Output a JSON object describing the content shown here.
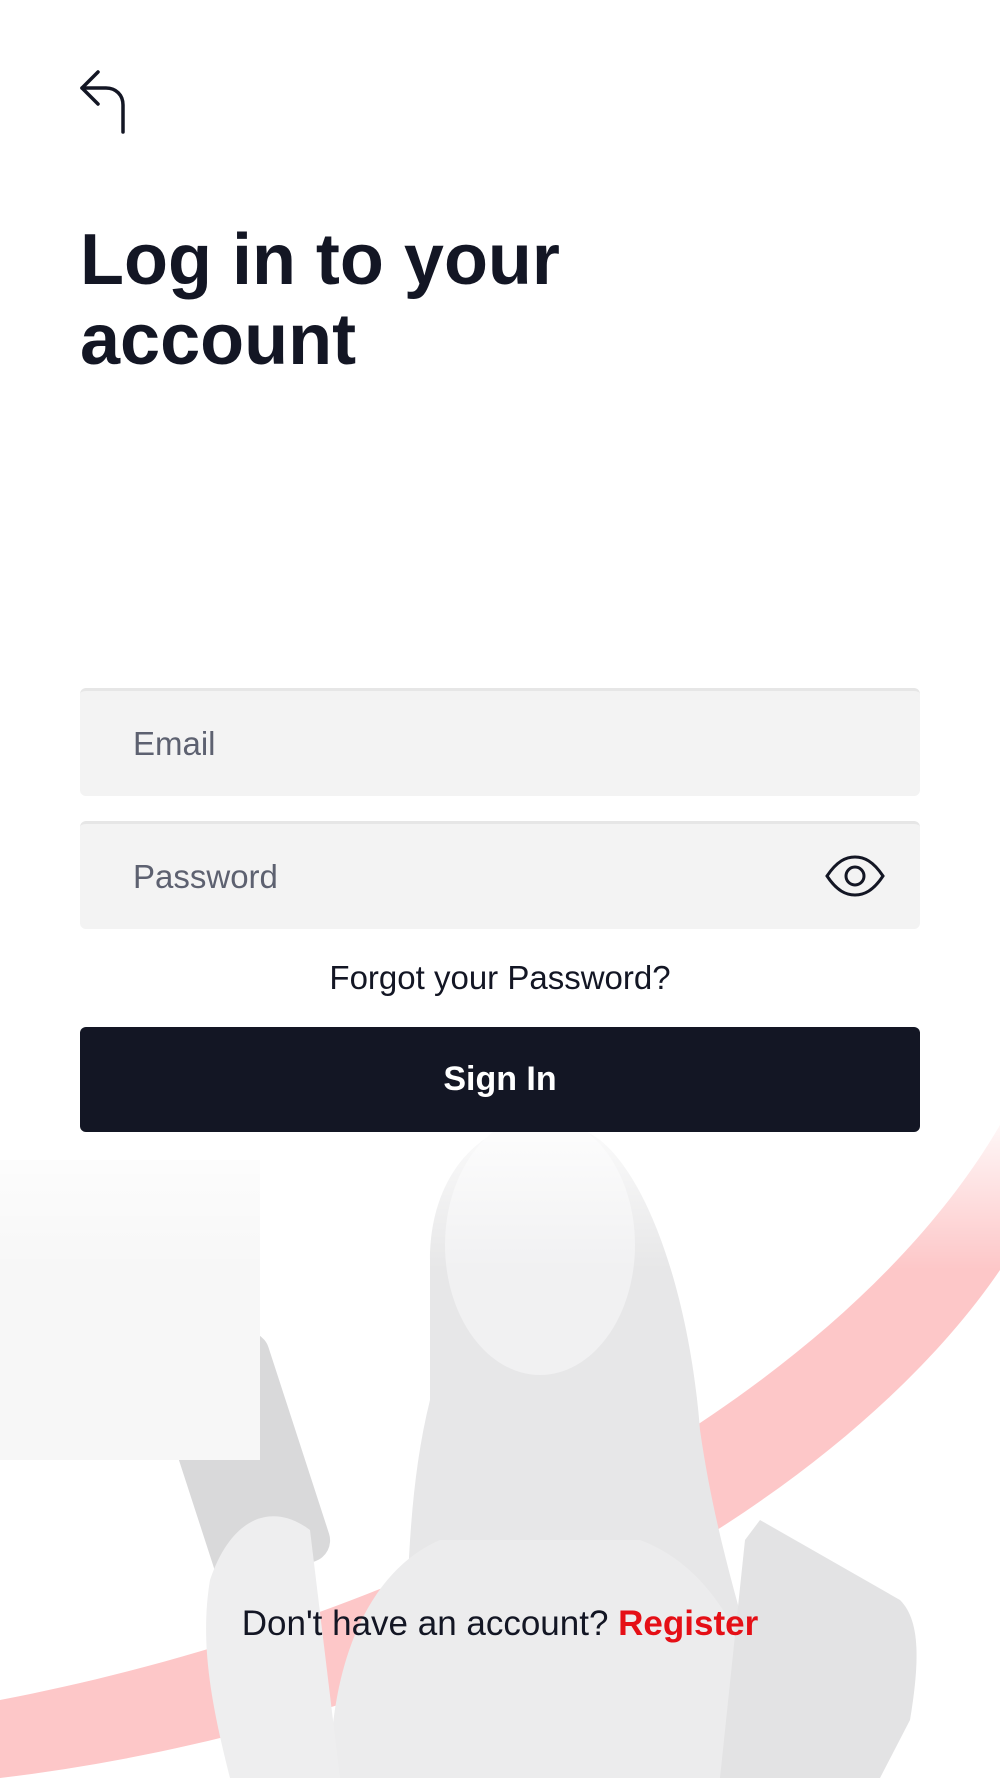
{
  "header": {
    "back_icon": "back-arrow-icon"
  },
  "title": "Log in to your account",
  "form": {
    "email_placeholder": "Email",
    "email_value": "",
    "password_placeholder": "Password",
    "password_value": "",
    "password_toggle_icon": "eye-icon",
    "forgot_label": "Forgot your Password?",
    "signin_label": "Sign In"
  },
  "footer": {
    "prompt": "Don't have an account?",
    "register_label": "Register"
  },
  "colors": {
    "primary": "#131624",
    "accent": "#e50f16",
    "accent_soft": "#fdc7c8",
    "input_bg": "#f3f3f3",
    "placeholder": "#5d6170"
  }
}
